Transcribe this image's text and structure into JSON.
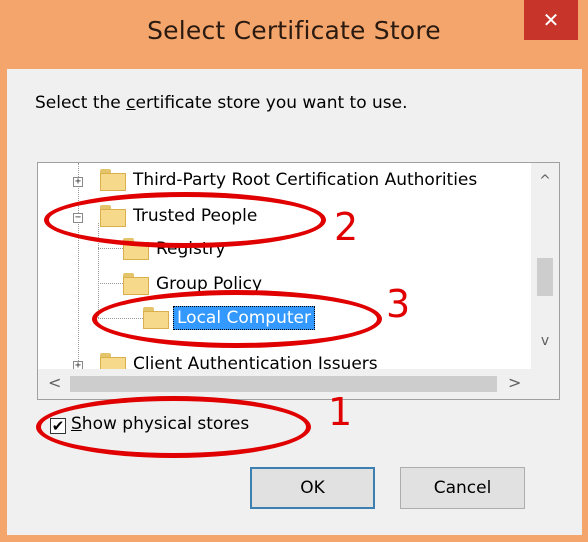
{
  "window": {
    "title": "Select Certificate Store",
    "close_glyph": "✕"
  },
  "prompt": {
    "pre": "Select the ",
    "mnemonic": "c",
    "post": "ertificate store you want to use."
  },
  "tree": {
    "items": [
      {
        "label": "Third-Party Root Certification Authorities",
        "expander": "+"
      },
      {
        "label": "Trusted People",
        "expander": "−"
      },
      {
        "label": "Registry",
        "expander": ""
      },
      {
        "label": "Group Policy",
        "expander": ""
      },
      {
        "label": "Local Computer",
        "expander": "",
        "selected": true
      },
      {
        "label": "Client Authentication Issuers",
        "expander": "+"
      }
    ],
    "scroll_up": "^",
    "scroll_down": "v",
    "scroll_left": "<",
    "scroll_right": ">"
  },
  "checkbox": {
    "checked": true,
    "check_glyph": "✔",
    "mnemonic": "S",
    "label_rest": "how physical stores"
  },
  "buttons": {
    "ok": "OK",
    "cancel": "Cancel"
  },
  "annotations": {
    "one": "1",
    "two": "2",
    "three": "3",
    "color": "#e00000"
  },
  "colors": {
    "title_bar": "#f4a56c",
    "close": "#c7342a",
    "selection": "#3399ff"
  }
}
